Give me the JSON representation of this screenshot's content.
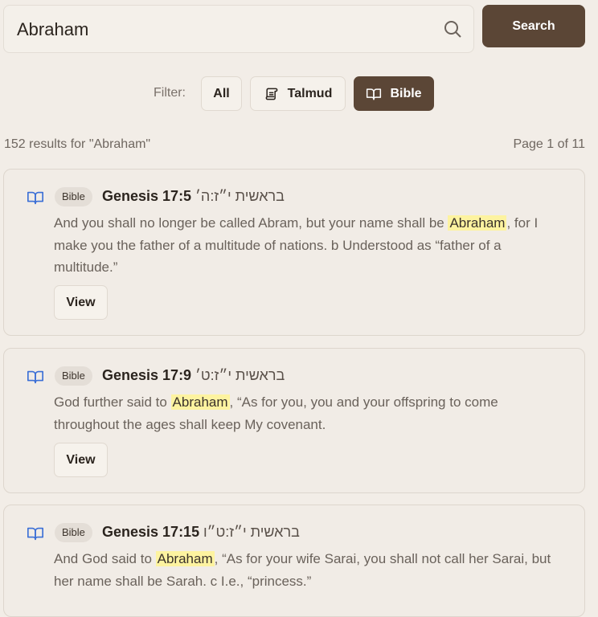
{
  "search": {
    "value": "Abraham",
    "button_label": "Search"
  },
  "filter": {
    "label": "Filter:",
    "options": [
      {
        "label": "All",
        "icon": "none",
        "active": false
      },
      {
        "label": "Talmud",
        "icon": "scroll-icon",
        "active": false
      },
      {
        "label": "Bible",
        "icon": "book-open-icon",
        "active": true
      }
    ]
  },
  "results": {
    "count_text": "152 results for \"Abraham\"",
    "page_text": "Page 1 of 11",
    "items": [
      {
        "badge": "Bible",
        "reference": "Genesis 17:5",
        "hebrew": "בראשית י״ז:ה׳",
        "text_before": "And you shall no longer be called Abram, but your name shall be ",
        "highlight": "Abraham",
        "text_after": ", for I make you the father of a multitude of nations. b Understood as “father of a multitude.”",
        "view_label": "View"
      },
      {
        "badge": "Bible",
        "reference": "Genesis 17:9",
        "hebrew": "בראשית י״ז:ט׳",
        "text_before": "God further said to ",
        "highlight": "Abraham",
        "text_after": ", “As for you, you and your offspring to come throughout the ages shall keep My covenant.",
        "view_label": "View"
      },
      {
        "badge": "Bible",
        "reference": "Genesis 17:15",
        "hebrew": "בראשית י״ז:ט״ו",
        "text_before": "And God said to ",
        "highlight": "Abraham",
        "text_after": ", “As for your wife Sarai, you shall not call her Sarai, but her name shall be Sarah. c I.e., “princess.”",
        "view_label": "View"
      }
    ]
  },
  "colors": {
    "accent": "#5b4636",
    "highlight": "#fdf3a0",
    "icon_blue": "#3b6fd6",
    "background": "#f2ede7"
  }
}
